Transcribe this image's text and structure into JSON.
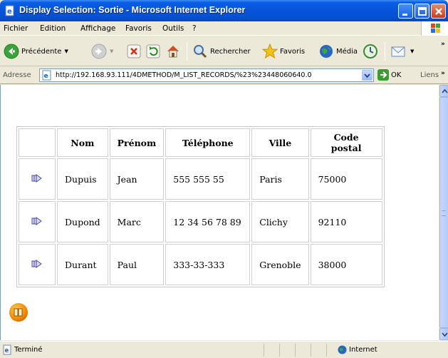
{
  "window": {
    "title": "Display Selection: Sortie - Microsoft Internet Explorer"
  },
  "menu": {
    "items": [
      "Fichier",
      "Edition",
      "Affichage",
      "Favoris",
      "Outils",
      "?"
    ]
  },
  "toolbar": {
    "back_label": "Précédente",
    "search_label": "Rechercher",
    "favorites_label": "Favoris",
    "media_label": "Média"
  },
  "address": {
    "label": "Adresse",
    "url": "http://192.168.93.111/4DMETHOD/M_LIST_RECORDS/%23%23448060640.0",
    "go_label": "OK",
    "links_label": "Liens"
  },
  "table": {
    "headers": [
      "Nom",
      "Prénom",
      "Téléphone",
      "Ville",
      "Code postal"
    ],
    "rows": [
      {
        "nom": "Dupuis",
        "prenom": "Jean",
        "telephone": "555 555 55",
        "ville": "Paris",
        "code_postal": "75000"
      },
      {
        "nom": "Dupond",
        "prenom": "Marc",
        "telephone": "12 34 56 78 89",
        "ville": "Clichy",
        "code_postal": "92110"
      },
      {
        "nom": "Durant",
        "prenom": "Paul",
        "telephone": "333-33-333",
        "ville": "Grenoble",
        "code_postal": "38000"
      }
    ]
  },
  "status": {
    "text": "Terminé",
    "zone": "Internet"
  },
  "icons": {
    "row_icon": "arrow-right-icon",
    "bottom_icon": "4d-logo-icon"
  }
}
